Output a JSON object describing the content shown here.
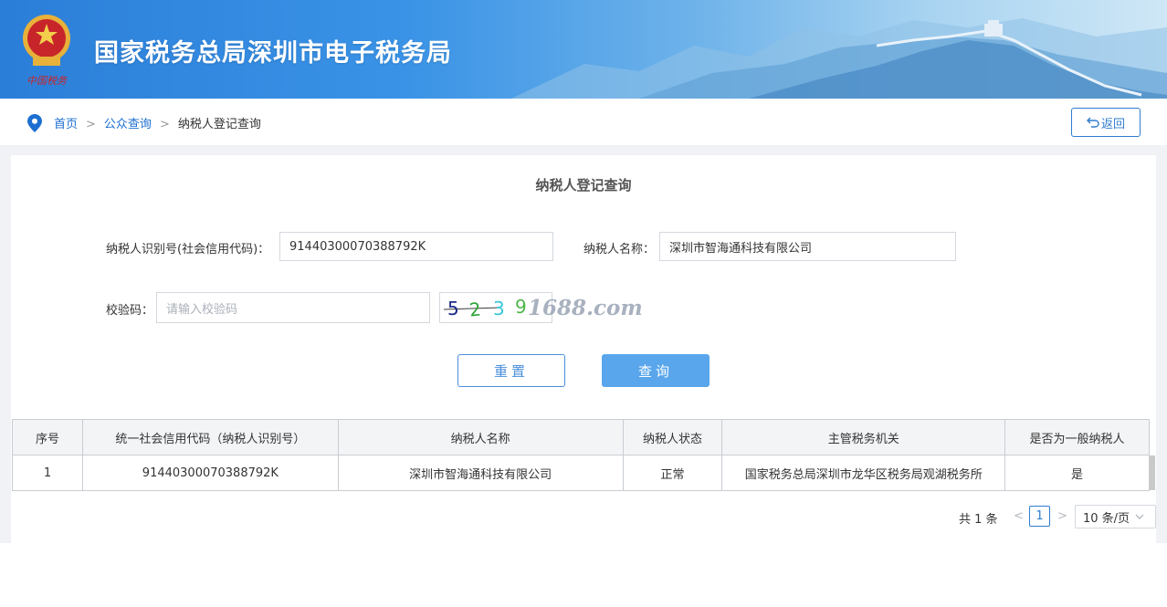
{
  "header": {
    "site_title": "国家税务总局深圳市电子税务局",
    "emblem_caption": "中国税务"
  },
  "breadcrumb": {
    "home": "首页",
    "sep1": ">",
    "public_query": "公众查询",
    "sep2": ">",
    "current": "纳税人登记查询"
  },
  "back_button": {
    "label": "返回"
  },
  "form": {
    "title": "纳税人登记查询",
    "taxpayer_id_label": "纳税人识别号(社会信用代码)：",
    "taxpayer_id_value": "91440300070388792K",
    "taxpayer_name_label": "纳税人名称：",
    "taxpayer_name_value": "深圳市智海通科技有限公司",
    "captcha_label": "校验码：",
    "captcha_placeholder": "请输入校验码",
    "captcha_digits": [
      "5",
      "2",
      "3",
      "9"
    ],
    "captcha_watermark": "1688.com",
    "reset_label": "重置",
    "query_label": "查询"
  },
  "table": {
    "columns": [
      "序号",
      "统一社会信用代码（纳税人识别号）",
      "纳税人名称",
      "纳税人状态",
      "主管税务机关",
      "是否为一般纳税人"
    ],
    "rows": [
      [
        "1",
        "91440300070388792K",
        "深圳市智海通科技有限公司",
        "正常",
        "国家税务总局深圳市龙华区税务局观湖税务所",
        "是"
      ]
    ]
  },
  "pagination": {
    "total_text": "共 1 条",
    "prev": "<",
    "current_page": "1",
    "next": ">",
    "page_size": "10 条/页"
  },
  "colors": {
    "link_blue": "#1c6fd1",
    "primary_button": "#59a6ec",
    "banner_start": "#2b7ed8"
  }
}
